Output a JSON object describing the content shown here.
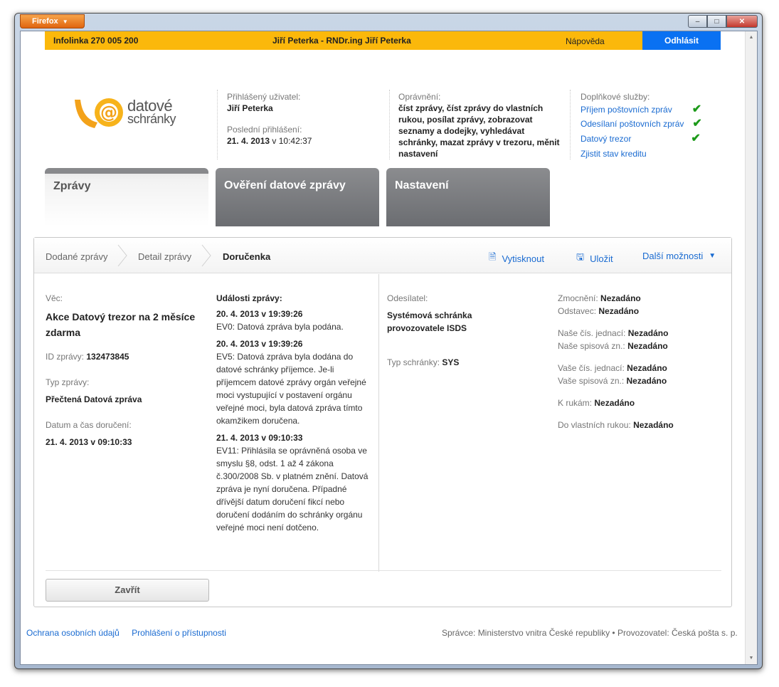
{
  "browser": {
    "menu_label": "Firefox",
    "controls": {
      "minimize": "–",
      "maximize": "□",
      "close": "✕"
    }
  },
  "topbar": {
    "infoline": "Infolinka 270 005 200",
    "user": "Jiří Peterka - RNDr.ing Jiří Peterka",
    "help": "Nápověda",
    "logout": "Odhlásit",
    "accent": "#fbb80b",
    "logout_color": "#0a71f2"
  },
  "logo": {
    "line1": "datové",
    "line2": "schránky",
    "icon": "at-sign-logo"
  },
  "user_info": {
    "logged_label": "Přihlášený uživatel:",
    "logged_value": "Jiří Peterka",
    "last_login_label": "Poslední přihlášení:",
    "last_login_date": "21. 4. 2013",
    "last_login_time": "v 10:42:37"
  },
  "permissions": {
    "label": "Oprávnění:",
    "value": "číst zprávy, číst zprávy do vlastních rukou, posílat zprávy, zobrazovat seznamy a dodejky, vyhledávat schránky, mazat zprávy v trezoru, měnit nastavení"
  },
  "addons": {
    "label": "Doplňkové služby:",
    "items": [
      {
        "label": "Příjem poštovních zpráv",
        "checked": true
      },
      {
        "label": "Odesílaní poštovních zpráv",
        "checked": true
      },
      {
        "label": "Datový trezor",
        "checked": true
      },
      {
        "label": "Zjistit stav kreditu",
        "checked": false
      }
    ]
  },
  "tabs": [
    {
      "label": "Zprávy",
      "active": true
    },
    {
      "label": "Ověření datové zprávy",
      "active": false
    },
    {
      "label": "Nastavení",
      "active": false
    }
  ],
  "breadcrumb": [
    "Dodané zprávy",
    "Detail zprávy",
    "Doručenka"
  ],
  "actions": {
    "print": "Vytisknout",
    "save": "Uložit",
    "more": "Další možnosti"
  },
  "message": {
    "subject_label": "Věc:",
    "subject": "Akce Datový trezor na 2 měsíce zdarma",
    "id_label": "ID zprávy:",
    "id": "132473845",
    "type_label": "Typ zprávy:",
    "type": "Přečtená Datová zpráva",
    "delivered_label": "Datum a čas doručení:",
    "delivered": "21. 4. 2013 v 09:10:33"
  },
  "events": {
    "label": "Události zprávy:",
    "items": [
      {
        "date": "20. 4. 2013 v 19:39:26",
        "text": "EV0: Datová zpráva byla podána."
      },
      {
        "date": "20. 4. 2013 v 19:39:26",
        "text": "EV5: Datová zpráva byla dodána do datové schránky příjemce. Je-li příjemcem datové zprávy orgán veřejné moci vystupující v postavení orgánu veřejné moci, byla datová zpráva tímto okamžikem doručena."
      },
      {
        "date": "21. 4. 2013 v 09:10:33",
        "text": "EV11: Přihlásila se oprávněná osoba ve smyslu §8, odst. 1 až 4 zákona č.300/2008 Sb. v platném znění. Datová zpráva je nyní doručena. Případné dřívější datum doručení fikcí nebo doručení dodáním do schránky orgánu veřejné moci není dotčeno."
      }
    ]
  },
  "sender": {
    "label": "Odesílatel:",
    "name": "Systémová schránka provozovatele ISDS",
    "box_type_label": "Typ schránky:",
    "box_type": "SYS"
  },
  "details": [
    {
      "label": "Zmocnění:",
      "value": "Nezadáno"
    },
    {
      "label": "Odstavec:",
      "value": "Nezadáno"
    },
    {
      "label": "Naše čís. jednací:",
      "value": "Nezadáno"
    },
    {
      "label": "Naše spisová zn.:",
      "value": "Nezadáno"
    },
    {
      "label": "Vaše čís. jednací:",
      "value": "Nezadáno"
    },
    {
      "label": "Vaše spisová zn.:",
      "value": "Nezadáno"
    },
    {
      "label": "K rukám:",
      "value": "Nezadáno"
    },
    {
      "label": "Do vlastních rukou:",
      "value": "Nezadáno"
    }
  ],
  "close_button": "Zavřít",
  "footer": {
    "links": [
      "Ochrana osobních údajů",
      "Prohlášení o přístupnosti"
    ],
    "credits": "Správce: Ministerstvo vnitra České republiky • Provozovatel: Česká pošta s. p."
  }
}
